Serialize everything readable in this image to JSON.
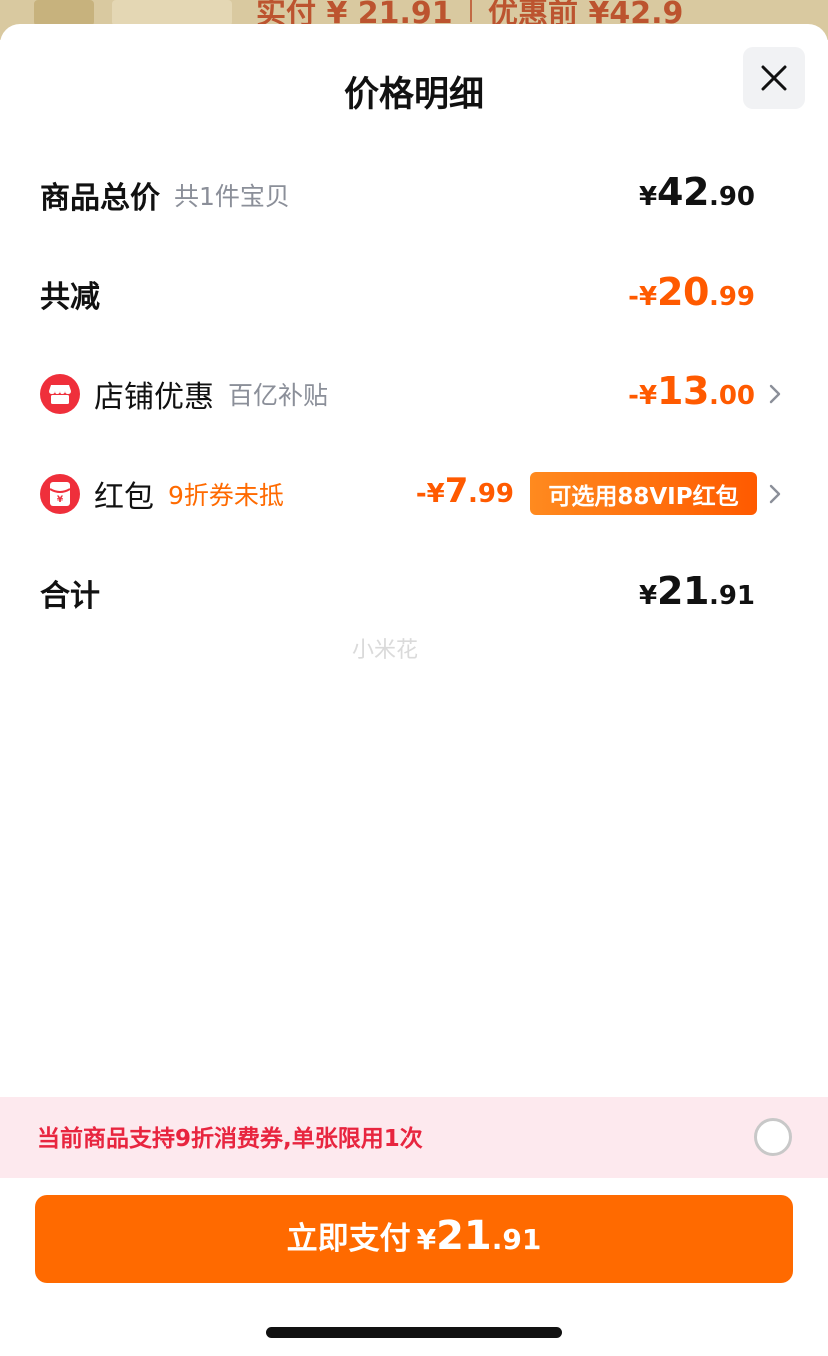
{
  "background": {
    "partial_text_left": "实付 ¥ 21.91",
    "partial_text_right": "优惠前 ¥42.9"
  },
  "sheet": {
    "title": "价格明细",
    "close_icon": "close-icon"
  },
  "rows": {
    "goods_total": {
      "label": "商品总价",
      "sub": "共1件宝贝",
      "currency": "¥",
      "amount_int": "42",
      "amount_dec": ".90"
    },
    "total_reduction": {
      "label": "共减",
      "currency": "-¥",
      "amount_int": "20",
      "amount_dec": ".99"
    },
    "store_discount": {
      "icon": "shop-icon",
      "label": "店铺优惠",
      "sub": "百亿补贴",
      "currency": "-¥",
      "amount_int": "13",
      "amount_dec": ".00"
    },
    "red_packet": {
      "icon": "red-envelope-icon",
      "label": "红包",
      "sub": "9折券未抵",
      "currency": "-¥",
      "amount_int": "7",
      "amount_dec": ".99",
      "vip_pill": "可选用88VIP红包"
    },
    "sum": {
      "label": "合计",
      "currency": "¥",
      "amount_int": "21",
      "amount_dec": ".91"
    }
  },
  "watermark": "小米花",
  "coupon_notice": {
    "text": "当前商品支持9折消费券,单张限用1次",
    "checked": false
  },
  "pay_button": {
    "label": "立即支付",
    "currency": "¥",
    "amount_int": "21",
    "amount_dec": ".91"
  },
  "colors": {
    "accent_orange": "#ff6a00",
    "discount_orange": "#ff5a00",
    "notice_red": "#e8253f",
    "notice_bg": "#fde9ee"
  }
}
